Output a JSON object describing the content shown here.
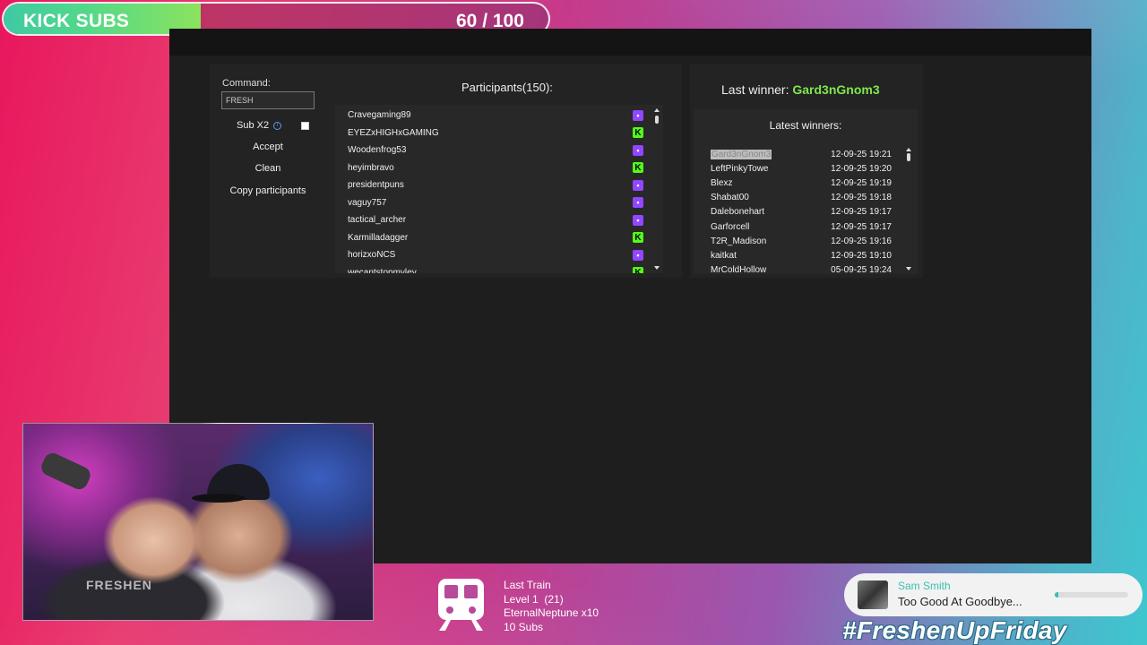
{
  "goal": {
    "label": "KICK SUBS",
    "current": 60,
    "target": 100,
    "display": "60 / 100"
  },
  "controls": {
    "command_label": "Command:",
    "command_value": "FRESH",
    "sub_label": "Sub X2",
    "accept_label": "Accept",
    "clean_label": "Clean",
    "copy_label": "Copy participants"
  },
  "participants": {
    "title": "Participants(150):",
    "items": [
      {
        "name": "Cravegaming89",
        "platform": "twitch"
      },
      {
        "name": "EYEZxHIGHxGAMING",
        "platform": "kick"
      },
      {
        "name": "Woodenfrog53",
        "platform": "twitch"
      },
      {
        "name": "heyimbravo",
        "platform": "kick"
      },
      {
        "name": "presidentpuns",
        "platform": "twitch"
      },
      {
        "name": "vaguy757",
        "platform": "twitch"
      },
      {
        "name": "tactical_archer",
        "platform": "twitch"
      },
      {
        "name": "Karmilladagger",
        "platform": "kick"
      },
      {
        "name": "horizxoNCS",
        "platform": "twitch"
      },
      {
        "name": "wecantstopmyley",
        "platform": "kick"
      }
    ]
  },
  "winners": {
    "last_winner_label": "Last winner: ",
    "last_winner_name": "Gard3nGnom3",
    "latest_title": "Latest winners:",
    "items": [
      {
        "name": "Gard3nGnom3",
        "time": "12-09-25 19:21",
        "selected": true
      },
      {
        "name": "LeftPinkyTowe",
        "time": "12-09-25 19:20"
      },
      {
        "name": "Blexz",
        "time": "12-09-25 19:19"
      },
      {
        "name": "Shabat00",
        "time": "12-09-25 19:18"
      },
      {
        "name": "Dalebonehart",
        "time": "12-09-25 19:17"
      },
      {
        "name": "Garforcell",
        "time": "12-09-25 19:17"
      },
      {
        "name": "T2R_Madison",
        "time": "12-09-25 19:16"
      },
      {
        "name": "kaitkat",
        "time": "12-09-25 19:10"
      },
      {
        "name": "MrColdHollow",
        "time": "05-09-25 19:24"
      }
    ]
  },
  "webcam": {
    "shirt_text": "FRESHEN"
  },
  "train": {
    "title": "Last Train",
    "level": "Level 1  (21)",
    "top": "EternalNeptune x10",
    "subs": "10 Subs"
  },
  "now_playing": {
    "artist": "Sam Smith",
    "title": "Too Good At Goodbye...",
    "progress": 0.05
  },
  "hashtag": "#FreshenUpFriday",
  "colors": {
    "twitch": "#9147ff",
    "kick": "#53fc18",
    "winner_highlight": "#7fe84b",
    "np_accent": "#3bc0b0"
  }
}
